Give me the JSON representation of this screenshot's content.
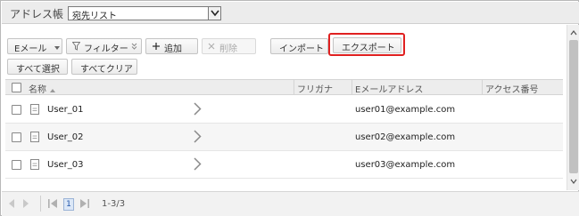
{
  "header": {
    "title": "アドレス帳",
    "list_select_value": "宛先リスト"
  },
  "toolbar": {
    "filter_type": "Eメール",
    "filter": "フィルター",
    "add": "追加",
    "delete": "削除",
    "import": "インポート",
    "export": "エクスポート",
    "select_all": "すべて選択",
    "clear_all": "すべてクリア"
  },
  "table": {
    "columns": [
      "名称",
      "フリガナ",
      "Eメールアドレス",
      "アクセス番号"
    ],
    "rows": [
      {
        "name": "User_01",
        "furigana": "",
        "email": "user01@example.com",
        "access_number": ""
      },
      {
        "name": "User_02",
        "furigana": "",
        "email": "user02@example.com",
        "access_number": ""
      },
      {
        "name": "User_03",
        "furigana": "",
        "email": "user03@example.com",
        "access_number": ""
      }
    ]
  },
  "pagination": {
    "current_page": "1",
    "range": "1-3/3"
  },
  "colors": {
    "highlight": "#e02020",
    "page_active": "#dbe7f7"
  }
}
